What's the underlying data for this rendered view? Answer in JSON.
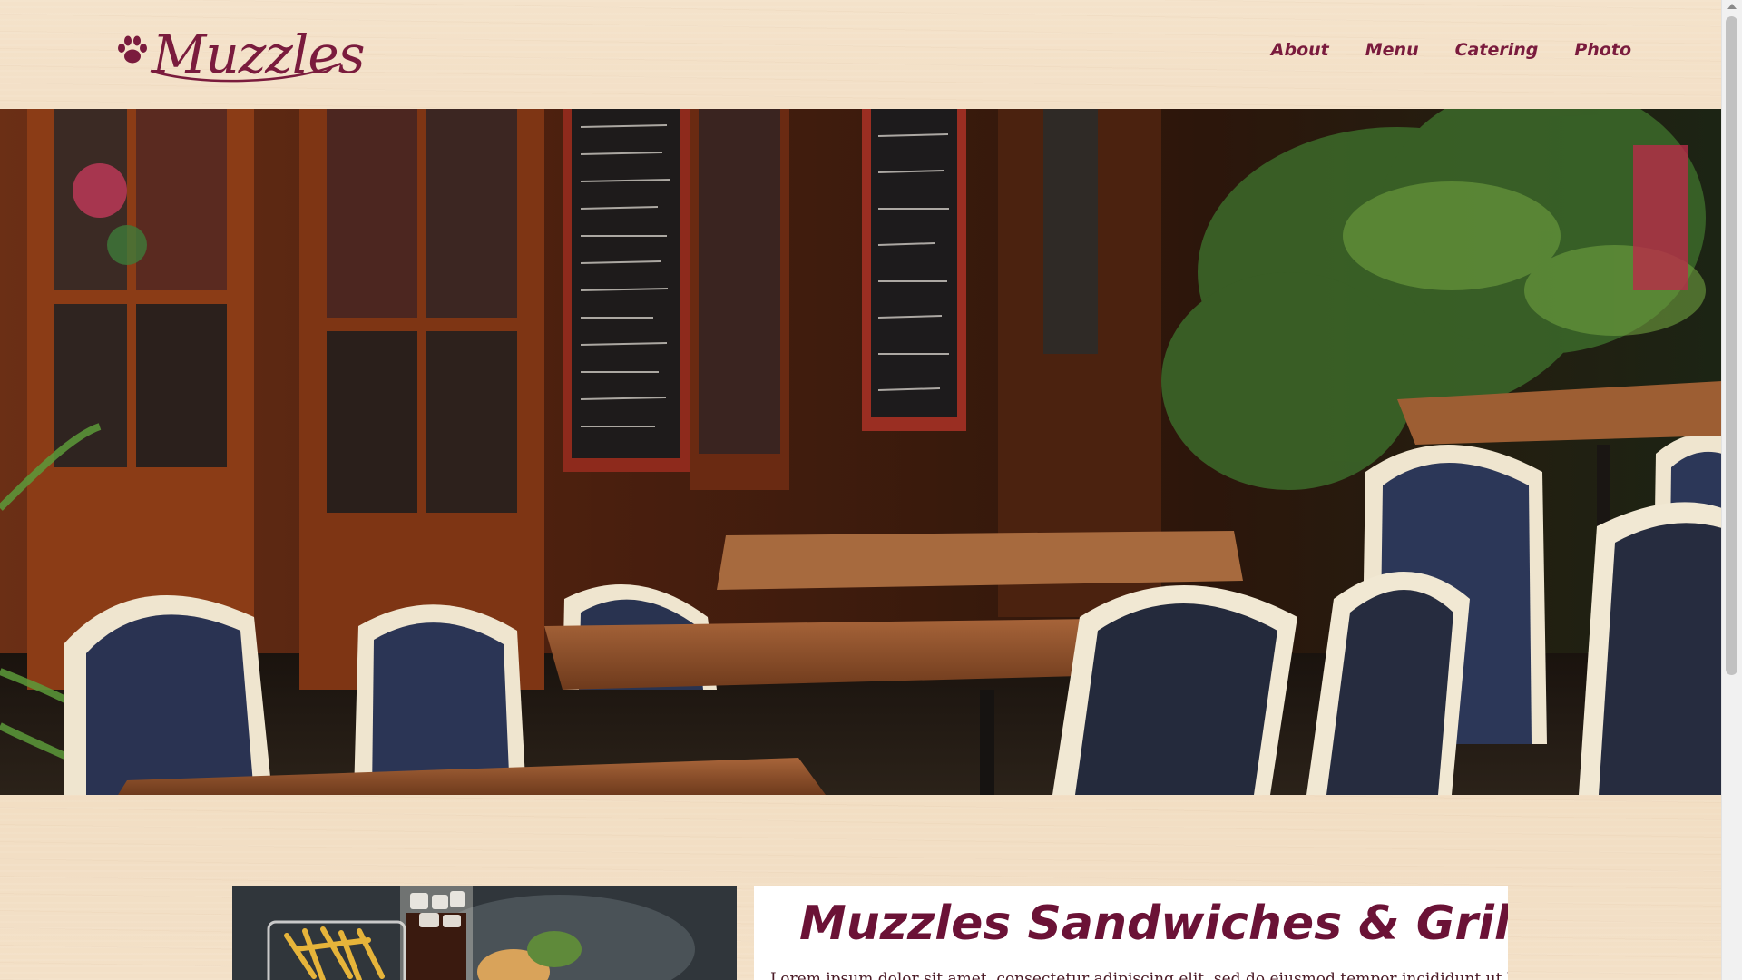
{
  "brand": {
    "logo_text": "Muzzles",
    "logo_icon": "paw-icon",
    "brand_color": "#7a1b3d"
  },
  "nav": {
    "items": [
      {
        "label": "About"
      },
      {
        "label": "Menu"
      },
      {
        "label": "Catering"
      },
      {
        "label": "Photo"
      }
    ]
  },
  "hero": {
    "image": "outdoor-cafe-terrace-photo"
  },
  "intro": {
    "title": "Muzzles Sandwiches & Grill",
    "body": "Lorem ipsum dolor sit amet, consectetur adipiscing elit, sed do eiusmod tempor incididunt ut labore et dolore",
    "image": "fries-and-drink-photo"
  },
  "colors": {
    "page_background": "#f1dcc1",
    "title_color": "#6b1236",
    "card_background": "#ffffff"
  }
}
